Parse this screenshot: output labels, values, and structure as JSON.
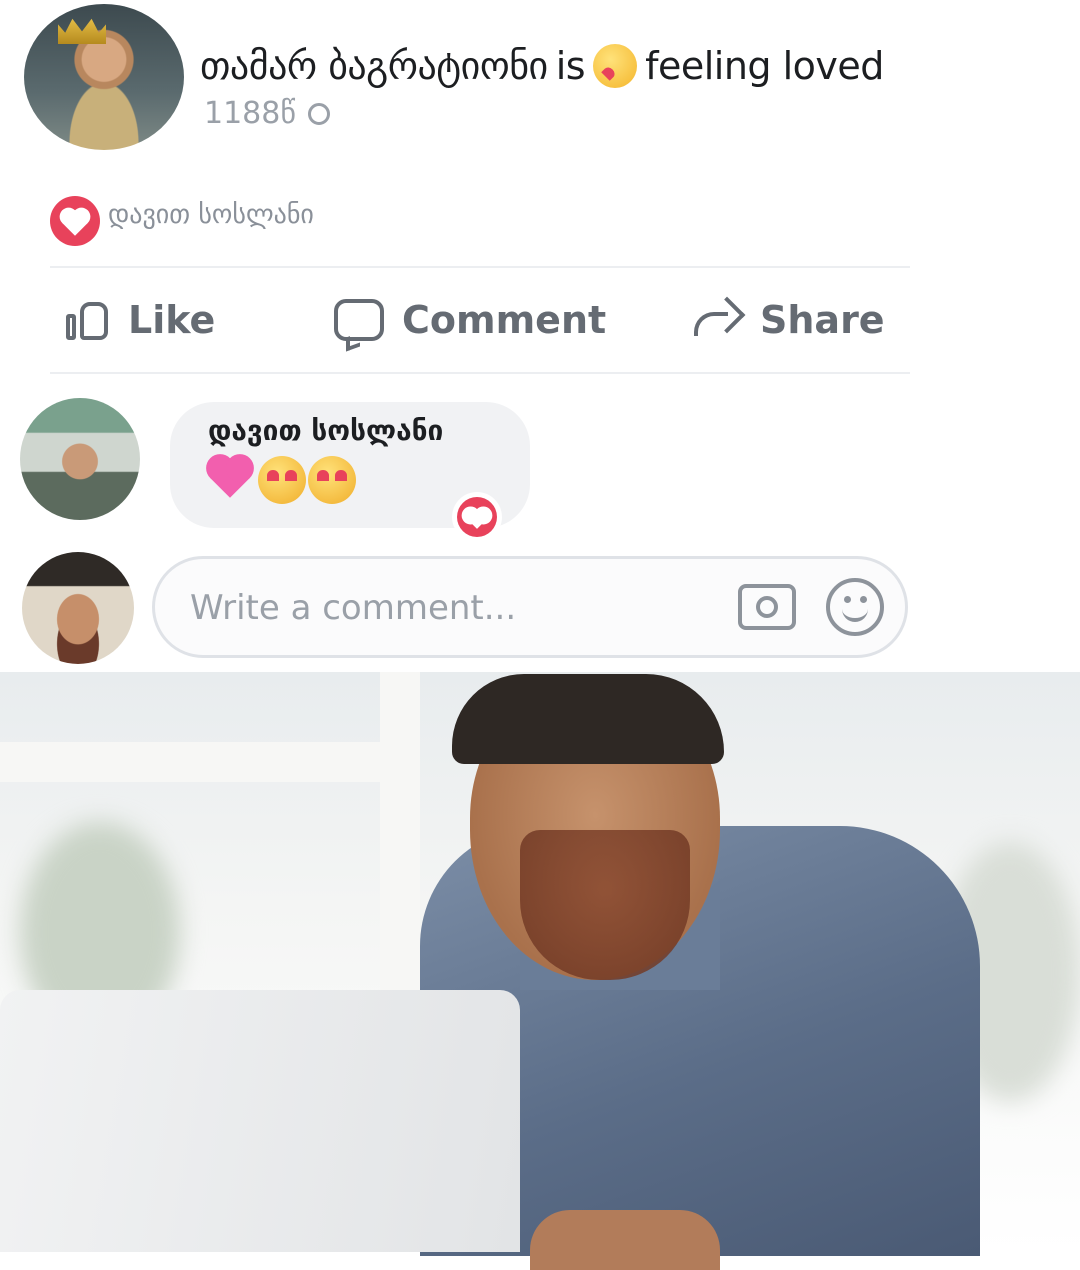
{
  "post": {
    "author": "თამარ ბაგრატიონი",
    "feeling_prefix": "is",
    "feeling_text": "feeling loved",
    "timestamp": "1188წ",
    "privacy_icon": "globe-icon"
  },
  "reactions": {
    "icon": "heart-reaction-icon",
    "names": "დავით სოსლანი"
  },
  "actions": {
    "like_label": "Like",
    "comment_label": "Comment",
    "share_label": "Share"
  },
  "comment": {
    "author": "დავით სოსლანი",
    "emojis": [
      "sparkling-heart",
      "heart-eyes",
      "heart-eyes"
    ],
    "reaction_icon": "heart-reaction-icon"
  },
  "composer": {
    "placeholder": "Write a comment...",
    "camera_icon": "camera-icon",
    "emoji_icon": "smile-icon"
  },
  "colors": {
    "reaction_red": "#e8425b",
    "action_gray": "#656b73",
    "bubble_bg": "#f1f2f4",
    "shirt_blue": "#5b6d88"
  }
}
